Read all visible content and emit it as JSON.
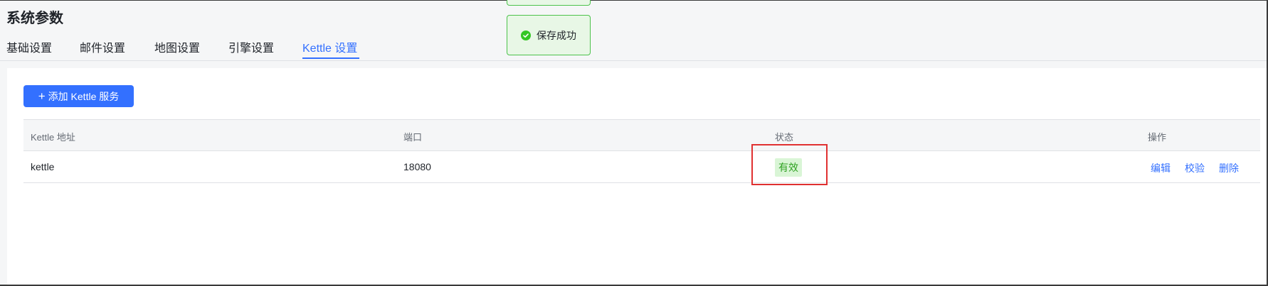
{
  "page": {
    "title": "系统参数"
  },
  "tabs": [
    {
      "label": "基础设置"
    },
    {
      "label": "邮件设置"
    },
    {
      "label": "地图设置"
    },
    {
      "label": "引擎设置"
    },
    {
      "label": "Kettle 设置"
    }
  ],
  "active_tab": "Kettle 设置",
  "toolbar": {
    "add_label": "添加 Kettle 服务"
  },
  "table": {
    "columns": [
      "Kettle 地址",
      "端口",
      "状态",
      "操作"
    ],
    "rows": [
      {
        "address": "kettle",
        "port": "18080",
        "status": "有效",
        "actions": [
          "编辑",
          "校验",
          "删除"
        ]
      }
    ]
  },
  "toast": {
    "message": "保存成功",
    "icon": "check-circle-icon"
  },
  "colors": {
    "accent": "#3370ff",
    "success": "#2ea121",
    "highlight": "#e03131"
  }
}
